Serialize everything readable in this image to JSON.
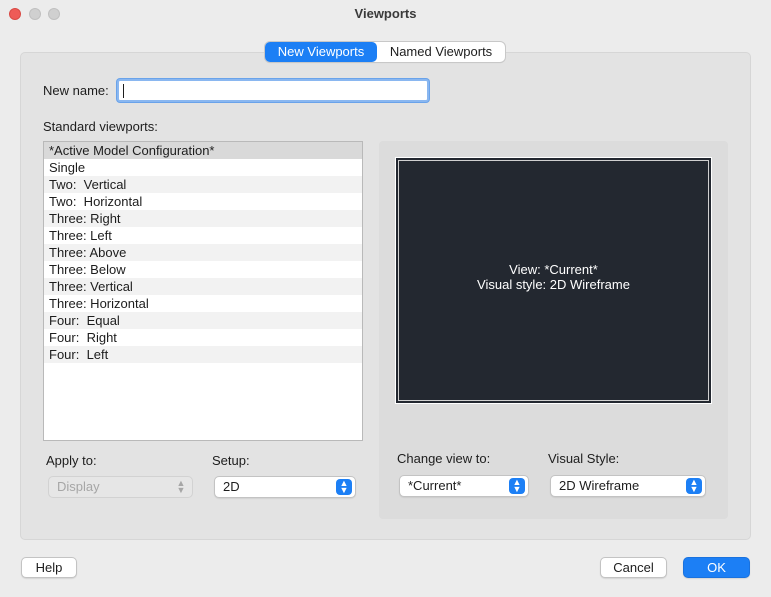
{
  "window": {
    "title": "Viewports"
  },
  "tabs": [
    {
      "label": "New Viewports",
      "active": true
    },
    {
      "label": "Named Viewports",
      "active": false
    }
  ],
  "new_name": {
    "label": "New name:",
    "value": ""
  },
  "standard_viewports": {
    "label": "Standard viewports:",
    "items": [
      "*Active Model Configuration*",
      "Single",
      "Two:  Vertical",
      "Two:  Horizontal",
      "Three: Right",
      "Three: Left",
      "Three: Above",
      "Three: Below",
      "Three: Vertical",
      "Three: Horizontal",
      "Four:  Equal",
      "Four:  Right",
      "Four:  Left"
    ],
    "selected_index": 0
  },
  "apply_to": {
    "label": "Apply to:",
    "value": "Display",
    "enabled": false
  },
  "setup": {
    "label": "Setup:",
    "value": "2D"
  },
  "preview": {
    "line1": "View: *Current*",
    "line2": "Visual style: 2D Wireframe"
  },
  "change_view_to": {
    "label": "Change view to:",
    "value": "*Current*"
  },
  "visual_style": {
    "label": "Visual Style:",
    "value": "2D Wireframe"
  },
  "buttons": {
    "help": "Help",
    "cancel": "Cancel",
    "ok": "OK"
  },
  "colors": {
    "accent": "#1c7ff5",
    "preview_bg": "#232830"
  }
}
